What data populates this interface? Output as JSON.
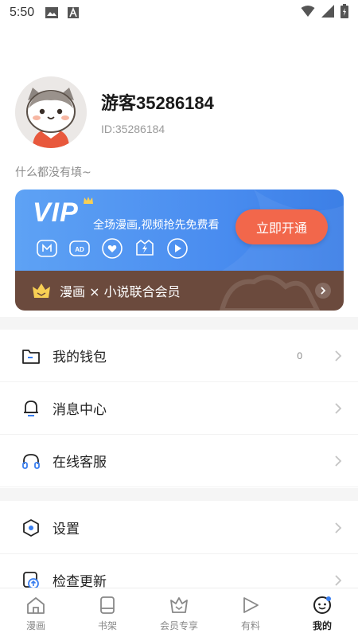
{
  "status_bar": {
    "time": "5:50"
  },
  "profile": {
    "username": "游客35286184",
    "user_id": "ID:35286184",
    "bio": "什么都没有填~"
  },
  "vip": {
    "logo": "VIP",
    "slogan": "全场漫画,视频抢先免费看",
    "open_button": "立即开通",
    "bundle_label": "漫画 × 小说联合会员",
    "benefit_icons": [
      "monthly-icon",
      "ad-free-icon",
      "heart-icon",
      "lightning-icon",
      "play-icon"
    ],
    "colors": {
      "card_blue": "#4a8df0",
      "button": "#f2674b",
      "bottom_bar": "#6b4a3d"
    }
  },
  "menu": [
    {
      "label": "我的钱包",
      "icon": "wallet-icon",
      "count": "0"
    },
    {
      "label": "消息中心",
      "icon": "bell-icon"
    },
    {
      "label": "在线客服",
      "icon": "headset-icon"
    },
    {
      "label": "设置",
      "icon": "settings-icon"
    },
    {
      "label": "检查更新",
      "icon": "update-icon"
    }
  ],
  "tabs": [
    {
      "label": "漫画",
      "icon": "home-icon"
    },
    {
      "label": "书架",
      "icon": "bookshelf-icon"
    },
    {
      "label": "会员专享",
      "icon": "vip-crown-icon"
    },
    {
      "label": "有料",
      "icon": "play-icon"
    },
    {
      "label": "我的",
      "icon": "profile-face-icon",
      "active": true
    }
  ]
}
